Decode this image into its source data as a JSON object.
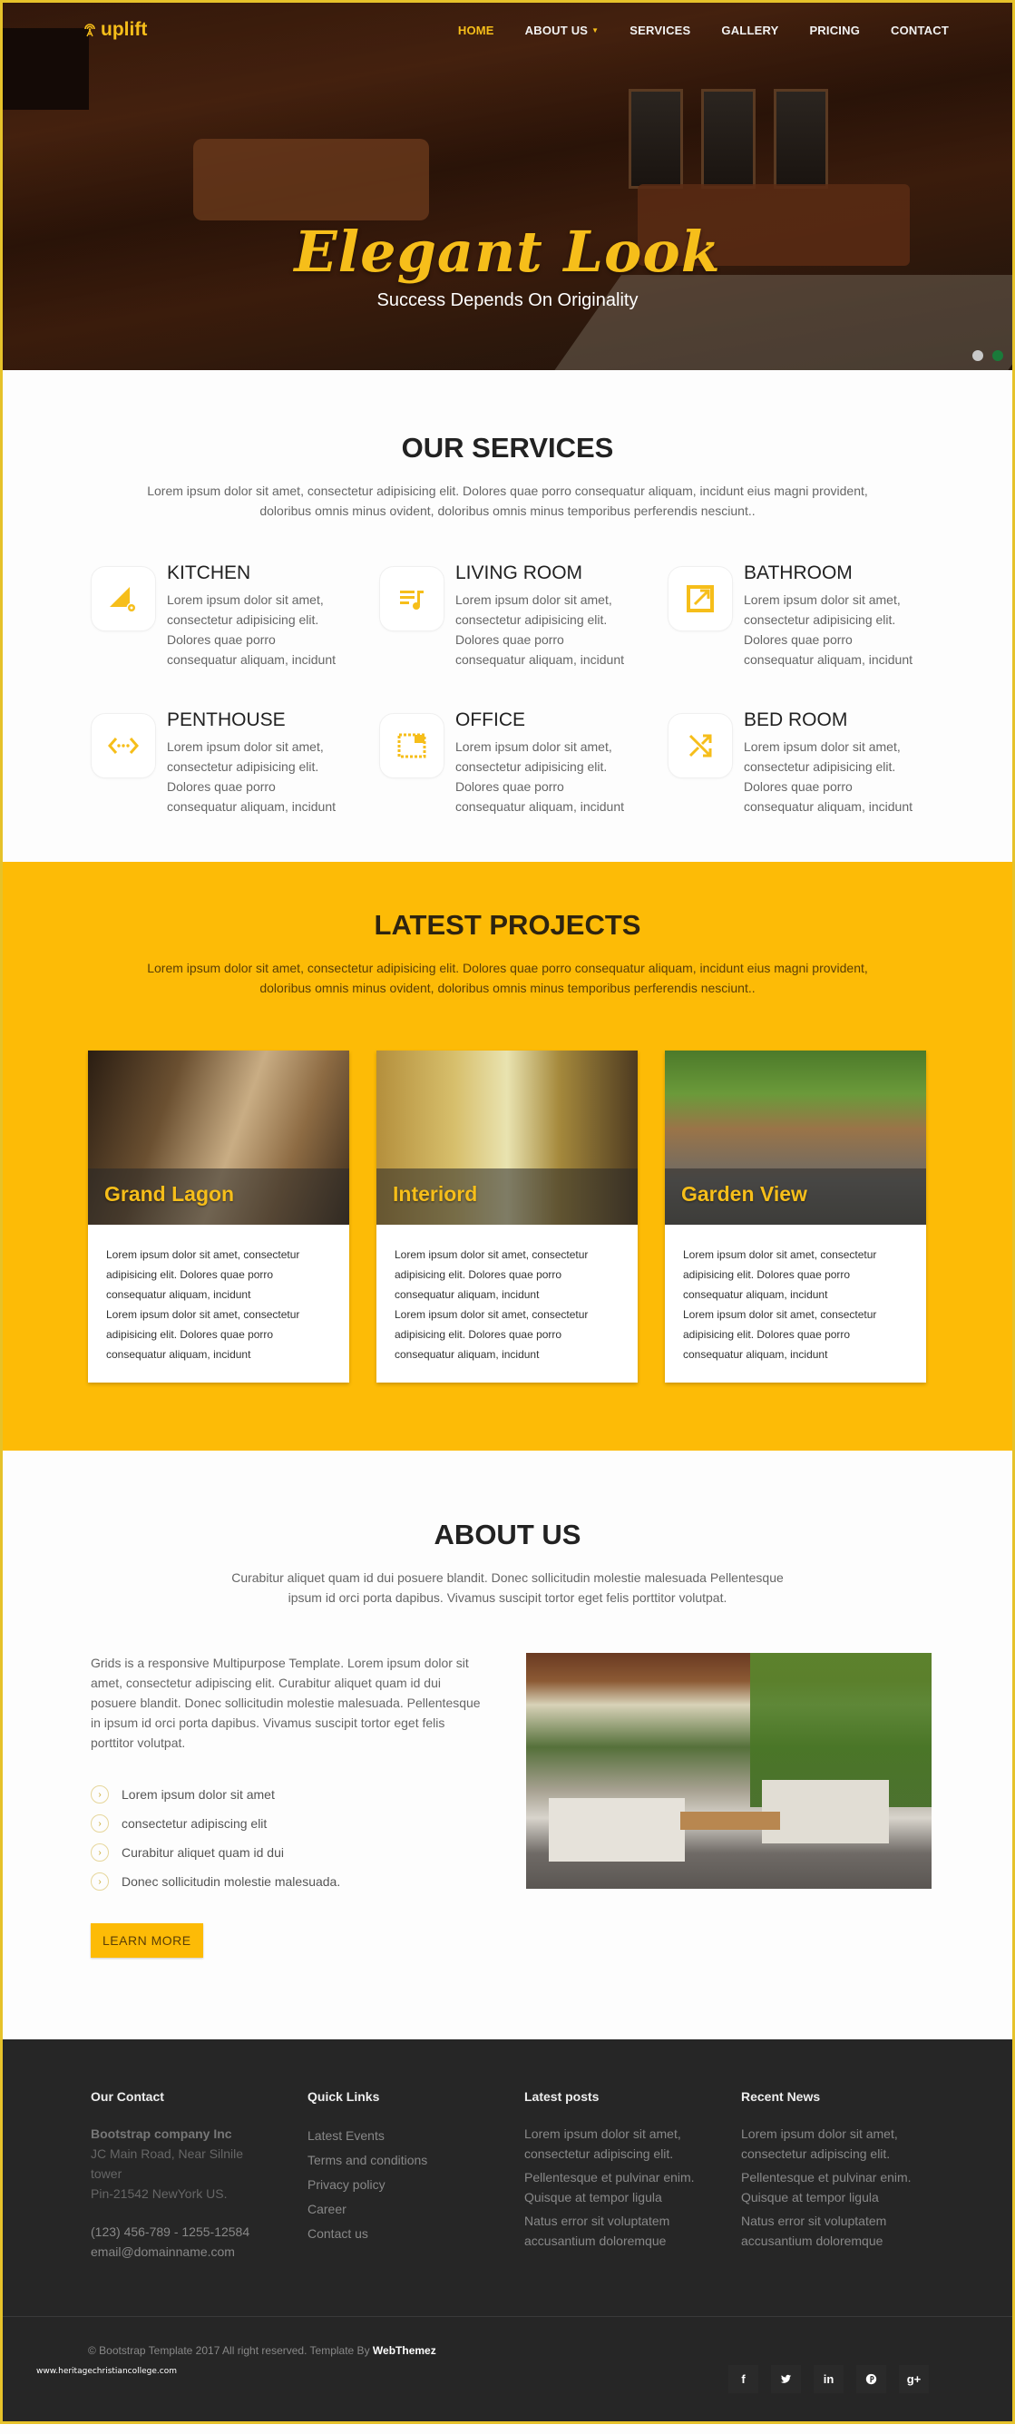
{
  "brand": {
    "name": "uplift",
    "accent": "#fdbb06",
    "logo_icon": "antenna-icon"
  },
  "nav": {
    "items": [
      {
        "label": "HOME",
        "active": true
      },
      {
        "label": "ABOUT US",
        "has_dropdown": true
      },
      {
        "label": "SERVICES"
      },
      {
        "label": "GALLERY"
      },
      {
        "label": "PRICING"
      },
      {
        "label": "CONTACT"
      }
    ]
  },
  "hero": {
    "title": "Elegant Look",
    "subtitle": "Success Depends On Originality",
    "slider_dots": 2
  },
  "services": {
    "title": "OUR SERVICES",
    "description": "Lorem ipsum dolor sit amet, consectetur adipisicing elit. Dolores quae porro consequatur aliquam, incidunt eius magni provident, doloribus omnis minus ovident, doloribus omnis minus temporibus perferendis nesciunt..",
    "items": [
      {
        "title": "KITCHEN",
        "icon": "kitchen-settings-icon",
        "text": "Lorem ipsum dolor sit amet, consectetur adipisicing elit. Dolores quae porro consequatur aliquam, incidunt"
      },
      {
        "title": "LIVING ROOM",
        "icon": "playlist-music-icon",
        "text": "Lorem ipsum dolor sit amet, consectetur adipisicing elit. Dolores quae porro consequatur aliquam, incidunt"
      },
      {
        "title": "BATHROOM",
        "icon": "open-external-icon",
        "text": "Lorem ipsum dolor sit amet, consectetur adipisicing elit. Dolores quae porro consequatur aliquam, incidunt"
      },
      {
        "title": "PENTHOUSE",
        "icon": "settings-ethernet-icon",
        "text": "Lorem ipsum dolor sit amet, consectetur adipisicing elit. Dolores quae porro consequatur aliquam, incidunt"
      },
      {
        "title": "OFFICE",
        "icon": "picture-in-picture-icon",
        "text": "Lorem ipsum dolor sit amet, consectetur adipisicing elit. Dolores quae porro consequatur aliquam, incidunt"
      },
      {
        "title": "BED ROOM",
        "icon": "shuffle-icon",
        "text": "Lorem ipsum dolor sit amet, consectetur adipisicing elit. Dolores quae porro consequatur aliquam, incidunt"
      }
    ]
  },
  "projects": {
    "title": "LATEST PROJECTS",
    "description": "Lorem ipsum dolor sit amet, consectetur adipisicing elit. Dolores quae porro consequatur aliquam, incidunt eius magni provident, doloribus omnis minus ovident, doloribus omnis minus temporibus perferendis nesciunt..",
    "items": [
      {
        "name": "Grand Lagon",
        "text1": "Lorem ipsum dolor sit amet, consectetur adipisicing elit. Dolores quae porro consequatur aliquam, incidunt",
        "text2": "Lorem ipsum dolor sit amet, consectetur adipisicing elit. Dolores quae porro consequatur aliquam, incidunt"
      },
      {
        "name": "Interiord",
        "text1": "Lorem ipsum dolor sit amet, consectetur adipisicing elit. Dolores quae porro consequatur aliquam, incidunt",
        "text2": "Lorem ipsum dolor sit amet, consectetur adipisicing elit. Dolores quae porro consequatur aliquam, incidunt"
      },
      {
        "name": "Garden View",
        "text1": "Lorem ipsum dolor sit amet, consectetur adipisicing elit. Dolores quae porro consequatur aliquam, incidunt",
        "text2": "Lorem ipsum dolor sit amet, consectetur adipisicing elit. Dolores quae porro consequatur aliquam, incidunt"
      }
    ]
  },
  "about": {
    "title": "ABOUT US",
    "description": "Curabitur aliquet quam id dui posuere blandit. Donec sollicitudin molestie malesuada Pellentesque ipsum id orci porta dapibus. Vivamus suscipit tortor eget felis porttitor volutpat.",
    "body": "Grids is a responsive Multipurpose Template. Lorem ipsum dolor sit amet, consectetur adipiscing elit. Curabitur aliquet quam id dui posuere blandit. Donec sollicitudin molestie malesuada. Pellentesque in ipsum id orci porta dapibus. Vivamus suscipit tortor eget felis porttitor volutpat.",
    "list": [
      "Lorem ipsum dolor sit amet",
      "consectetur adipiscing elit",
      "Curabitur aliquet quam id dui",
      "Donec sollicitudin molestie malesuada."
    ],
    "button": "LEARN MORE"
  },
  "footer": {
    "contact": {
      "title": "Our Contact",
      "company": "Bootstrap company Inc",
      "address": "JC Main Road, Near Silnile tower",
      "address2": "Pin-21542 NewYork US.",
      "phone": "(123) 456-789 - 1255-12584",
      "email": "email@domainname.com"
    },
    "quick_links": {
      "title": "Quick Links",
      "items": [
        "Latest Events",
        "Terms and conditions",
        "Privacy policy",
        "Career",
        "Contact us"
      ]
    },
    "latest_posts": {
      "title": "Latest posts",
      "items": [
        "Lorem ipsum dolor sit amet, consectetur adipiscing elit.",
        "Pellentesque et pulvinar enim. Quisque at tempor ligula",
        "Natus error sit voluptatem accusantium doloremque"
      ]
    },
    "recent_news": {
      "title": "Recent News",
      "items": [
        "Lorem ipsum dolor sit amet, consectetur adipiscing elit.",
        "Pellentesque et pulvinar enim. Quisque at tempor ligula",
        "Natus error sit voluptatem accusantium doloremque"
      ]
    },
    "copyright": "© Bootstrap Template 2017 All right reserved. Template By",
    "copyright_brand": "WebThemez",
    "watermark": "www.heritagechristiancollege.com",
    "social": [
      {
        "name": "facebook",
        "glyph": "f"
      },
      {
        "name": "twitter",
        "glyph": "t"
      },
      {
        "name": "linkedin",
        "glyph": "in"
      },
      {
        "name": "pinterest",
        "glyph": "p"
      },
      {
        "name": "google-plus",
        "glyph": "g+"
      }
    ]
  }
}
